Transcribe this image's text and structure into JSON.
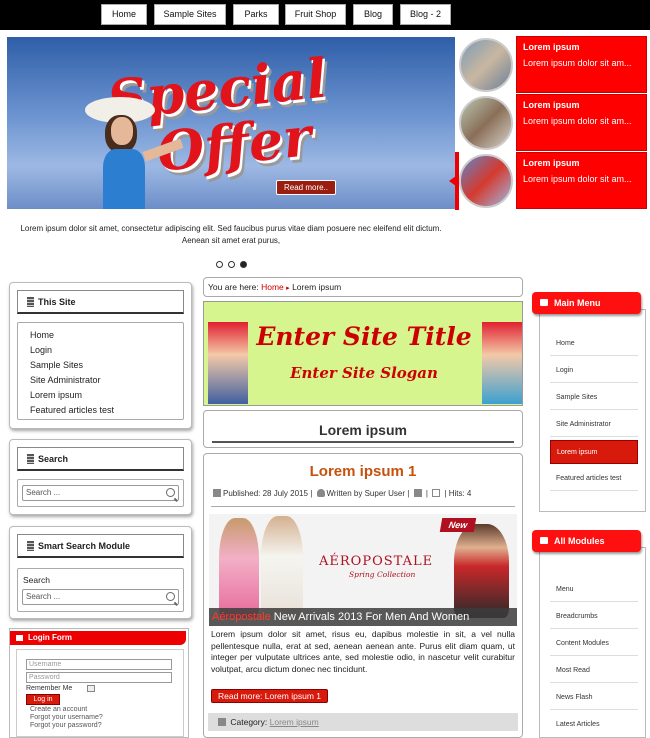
{
  "topnav": [
    "Home",
    "Sample Sites",
    "Parks",
    "Fruit Shop",
    "Blog",
    "Blog - 2"
  ],
  "slider": {
    "wordart_1": "Special",
    "wordart_2": "Offer",
    "read_more": "Read more..",
    "caption": "Lorem ipsum dolor sit amet, consectetur adipiscing elit. Sed faucibus purus vitae diam posuere nec eleifend elit dictum. Aenean sit amet erat purus,",
    "items": [
      {
        "title": "Lorem ipsum",
        "text": "Lorem ipsum dolor sit am..."
      },
      {
        "title": "Lorem ipsum",
        "text": "Lorem ipsum dolor sit am..."
      },
      {
        "title": "Lorem ipsum",
        "text": "Lorem ipsum dolor sit am..."
      }
    ]
  },
  "left": {
    "this_site": {
      "title": "This Site",
      "items": [
        "Home",
        "Login",
        "Sample Sites",
        "Site Administrator",
        "Lorem ipsum",
        "Featured articles test"
      ]
    },
    "search": {
      "title": "Search",
      "placeholder": "Search ..."
    },
    "smart_search": {
      "title": "Smart Search Module",
      "label": "Search",
      "placeholder": "Search ..."
    },
    "login": {
      "title": "Login Form",
      "username": "Username",
      "password": "Password",
      "remember": "Remember Me",
      "button": "Log in",
      "links": [
        "Create an account",
        "Forgot your username?",
        "Forgot your password?"
      ]
    }
  },
  "center": {
    "breadcrumb": {
      "prefix": "You are here:",
      "home": "Home",
      "current": "Lorem ipsum"
    },
    "banner": {
      "title": "Enter Site Title",
      "slogan": "Enter Site Slogan"
    },
    "page_heading": "Lorem ipsum",
    "article": {
      "title": "Lorem ipsum 1",
      "published": "Published: 28 July 2015",
      "author": "Written by Super User",
      "hits": "Hits: 4",
      "image_brand": "AÉROPOSTALE",
      "image_sub": "Spring Collection",
      "image_new": "New",
      "image_strip_red": "Aéropostale",
      "image_strip_rest": " New Arrivals 2013 For Men And Women",
      "body": "Lorem ipsum dolor sit amet, risus eu, dapibus molestie in sit, a vel nulla pellentesque nulla, erat at sed, aenean aenean ante. Purus elit diam quam, ut integer per vulputate ultrices ante, sed molestie odio, in nascetur velit curabitur volutpat, arcu dictum donec nec tincidunt.",
      "read_more": "Read more: Lorem ipsum 1",
      "category_label": "Category:",
      "category": "Lorem ipsum"
    }
  },
  "right": {
    "main_menu": {
      "title": "Main Menu",
      "items": [
        "Home",
        "Login",
        "Sample Sites",
        "Site Administrator",
        "Lorem ipsum",
        "Featured articles test"
      ],
      "active": 4
    },
    "all_modules": {
      "title": "All Modules",
      "items": [
        "Menu",
        "Breadcrumbs",
        "Content Modules",
        "Most Read",
        "News Flash",
        "Latest Articles"
      ]
    }
  },
  "colors": {
    "accent": "#ff0000",
    "article_title": "#c6520d",
    "banner_bg": "#d7f58e"
  }
}
